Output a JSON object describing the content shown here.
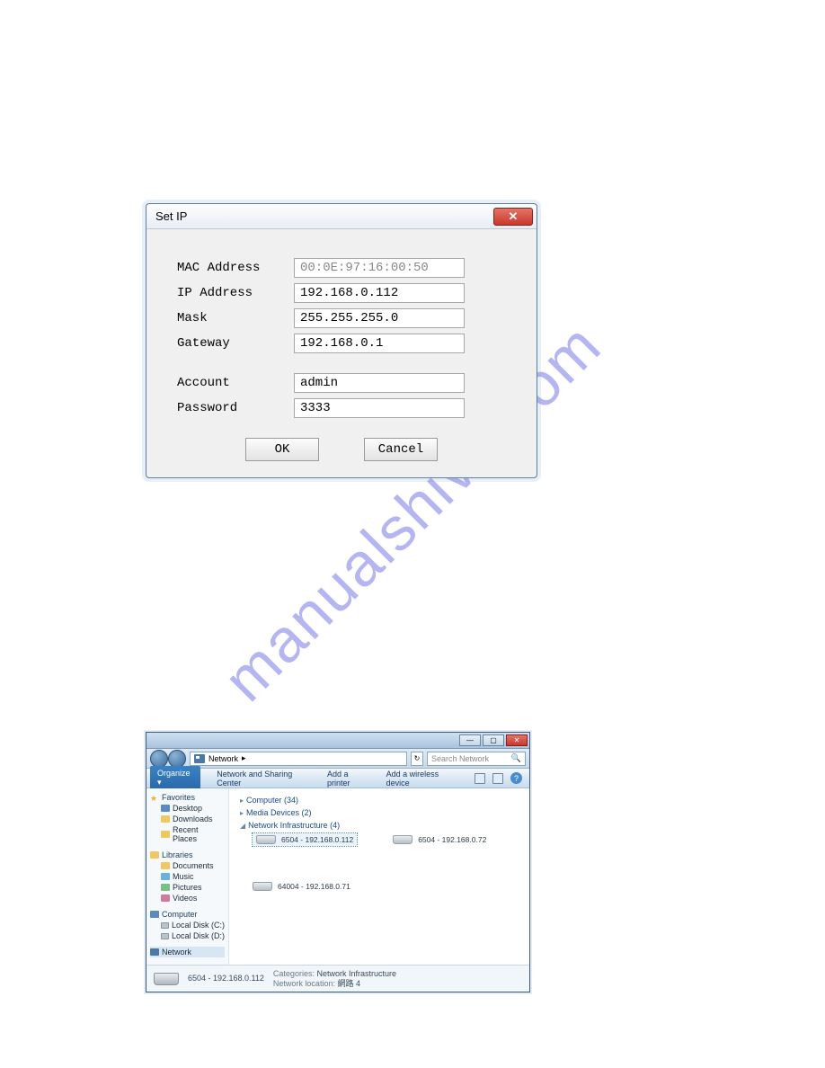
{
  "watermark": "manualshive.com",
  "dialog": {
    "title": "Set IP",
    "fields": {
      "mac_label": "MAC Address",
      "mac_value": "00:0E:97:16:00:50",
      "ip_label": "IP Address",
      "ip_value": "192.168.0.112",
      "mask_label": "Mask",
      "mask_value": "255.255.255.0",
      "gateway_label": "Gateway",
      "gateway_value": "192.168.0.1",
      "account_label": "Account",
      "account_value": "admin",
      "password_label": "Password",
      "password_value": "3333"
    },
    "buttons": {
      "ok": "OK",
      "cancel": "Cancel"
    }
  },
  "explorer": {
    "address": {
      "prefix_icon": "network",
      "path": "Network",
      "sep": "▸"
    },
    "search_placeholder": "Search Network",
    "toolbar": {
      "organize": "Organize ▾",
      "links": [
        "Network and Sharing Center",
        "Add a printer",
        "Add a wireless device"
      ]
    },
    "sidebar": {
      "favorites": {
        "title": "Favorites",
        "items": [
          "Desktop",
          "Downloads",
          "Recent Places"
        ]
      },
      "libraries": {
        "title": "Libraries",
        "items": [
          "Documents",
          "Music",
          "Pictures",
          "Videos"
        ]
      },
      "computer": {
        "title": "Computer",
        "items": [
          "Local Disk (C:)",
          "Local Disk (D:)"
        ]
      },
      "network": {
        "title": "Network"
      }
    },
    "content": {
      "sections": [
        {
          "label": "Computer (34)",
          "expanded": false
        },
        {
          "label": "Media Devices (2)",
          "expanded": false
        },
        {
          "label": "Network Infrastructure (4)",
          "expanded": true
        }
      ],
      "devices": [
        {
          "label": "6504 - 192.168.0.112",
          "selected": true
        },
        {
          "label": "6504 - 192.168.0.72",
          "selected": false
        },
        {
          "label": "64004 - 192.168.0.71",
          "selected": false
        }
      ]
    },
    "statusbar": {
      "name": "6504 - 192.168.0.112",
      "categories_key": "Categories:",
      "categories_val": "Network Infrastructure",
      "location_key": "Network location:",
      "location_val": "網路 4"
    }
  }
}
